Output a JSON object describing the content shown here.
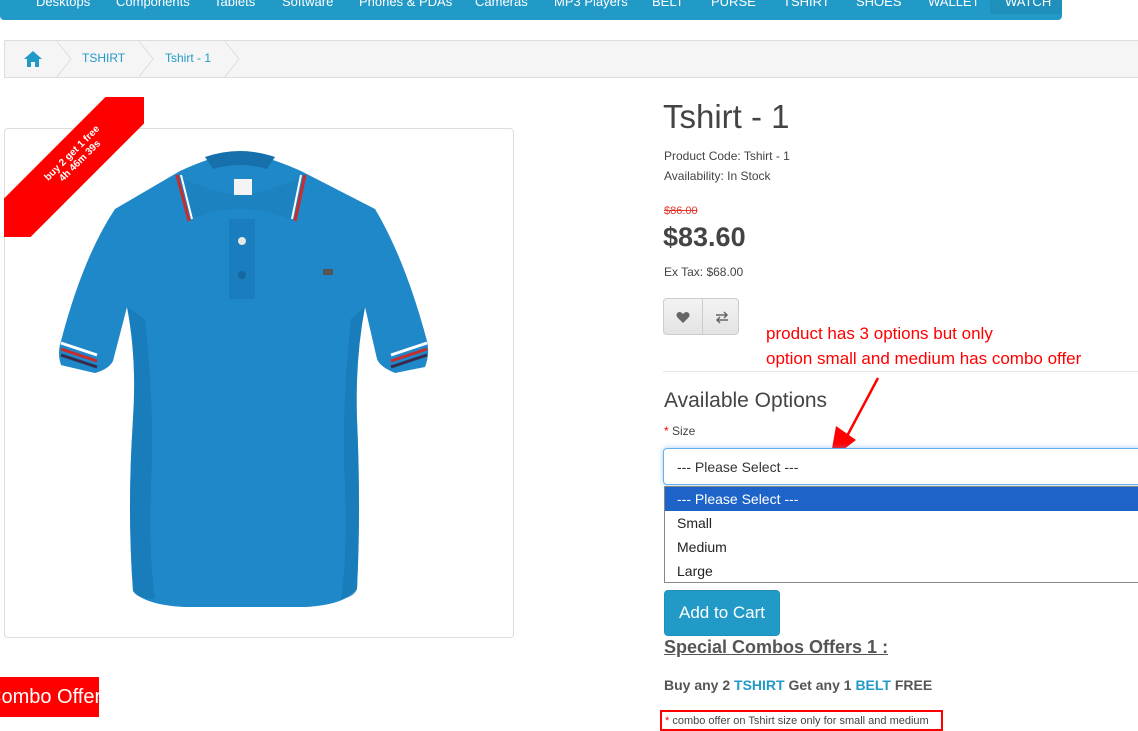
{
  "topnav": {
    "items": [
      "Desktops",
      "Components",
      "Tablets",
      "Software",
      "Phones & PDAs",
      "Cameras",
      "MP3 Players",
      "BELT",
      "PURSE",
      "TSHIRT",
      "SHOES",
      "WALLET",
      "WATCH"
    ]
  },
  "breadcrumb": {
    "home_icon": "home-icon",
    "items": [
      "TSHIRT",
      "Tshirt - 1"
    ]
  },
  "product": {
    "ribbon_line1": "buy 2 get 1 free",
    "ribbon_line2": "4h 46m 39s",
    "combo_offer_badge": "Combo Offer",
    "title": "Tshirt - 1",
    "code": "Product Code: Tshirt - 1",
    "availability": "Availability: In Stock",
    "old_price": "$86.00",
    "price": "$83.60",
    "ex_tax": "Ex Tax: $68.00",
    "wishlist_icon": "heart-icon",
    "compare_icon": "compare-arrows-icon"
  },
  "annotation": {
    "line1": "product has 3 options but only",
    "line2": "option small and medium has combo offer",
    "color": "#ff0000"
  },
  "options": {
    "heading": "Available Options",
    "required_mark": "*",
    "size_label": "Size",
    "selected": "--- Please Select ---",
    "list": [
      "--- Please Select ---",
      "Small",
      "Medium",
      "Large"
    ]
  },
  "cart": {
    "add_label": "Add to Cart"
  },
  "combos": {
    "heading": "Special Combos Offers 1 :",
    "buy_any": "Buy any",
    "buy_qty": "2",
    "buy_item": "TSHIRT",
    "get_any": "Get any",
    "get_qty": "1",
    "get_item": "BELT",
    "free": "FREE",
    "note_mark": "*",
    "note": "combo offer on Tshirt size only for small and medium"
  },
  "colors": {
    "accent": "#229ac8",
    "sale": "#ff0000",
    "shirt": "#1e88c9"
  }
}
